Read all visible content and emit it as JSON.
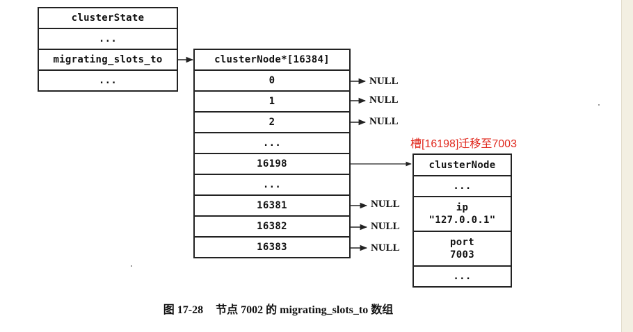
{
  "cluster_state": {
    "rows": [
      "clusterState",
      "...",
      "migrating_slots_to",
      "..."
    ]
  },
  "slots_array": {
    "rows": [
      "clusterNode*[16384]",
      "0",
      "1",
      "2",
      "...",
      "16198",
      "...",
      "16381",
      "16382",
      "16383"
    ]
  },
  "null_label": "NULL",
  "cluster_node": {
    "title": "clusterNode",
    "dots_top": "...",
    "ip_label": "ip",
    "ip_value": "\"127.0.0.1\"",
    "port_label": "port",
    "port_value": "7003",
    "dots_bottom": "..."
  },
  "annotation": "槽[16198]迁移至7003",
  "caption": {
    "figure_number": "图 17-28",
    "text": "节点 7002 的 migrating_slots_to 数组"
  },
  "colors": {
    "annotation": "#e0281d",
    "border": "#222222"
  }
}
